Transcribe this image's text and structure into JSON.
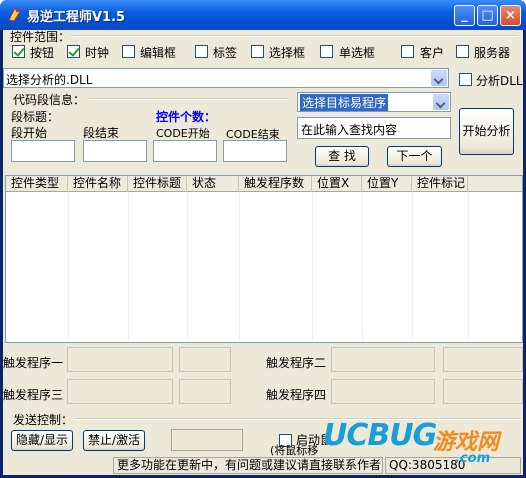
{
  "window": {
    "title": "易逆工程师V1.5",
    "min_label": "_",
    "max_label": "□",
    "close_label": "×"
  },
  "controls_range": {
    "label": "控件范围：",
    "items": [
      {
        "label": "按钮",
        "checked": true
      },
      {
        "label": "时钟",
        "checked": true
      },
      {
        "label": "编辑框",
        "checked": false
      },
      {
        "label": "标签",
        "checked": false
      },
      {
        "label": "选择框",
        "checked": false
      },
      {
        "label": "单选框",
        "checked": false
      },
      {
        "label": "客户",
        "checked": false
      },
      {
        "label": "服务器",
        "checked": false
      }
    ]
  },
  "dll_select": {
    "value": "选择分析的.DLL",
    "analyze_dll_label": "分析DLL",
    "analyze_dll_checked": false
  },
  "code_segment": {
    "group_label": "代码段信息：",
    "segment_title_label": "段标题：",
    "segment_start_label": "段开始",
    "segment_end_label": "段结束",
    "control_count_label": "控件个数：",
    "code_start_label": "CODE开始",
    "code_end_label": "CODE结束"
  },
  "target": {
    "program_select_value": "选择目标易程序",
    "search_input_value": "在此输入查找内容",
    "find_button": "查 找",
    "next_button": "下一个",
    "start_button": "开始分析"
  },
  "table": {
    "columns": [
      "控件类型",
      "控件名称",
      "控件标题",
      "状态",
      "触发程序数",
      "位置X",
      "位置Y",
      "控件标记"
    ],
    "rows": []
  },
  "triggers": {
    "trigger1_label": "触发程序一",
    "trigger2_label": "触发程序二",
    "trigger3_label": "触发程序三",
    "trigger4_label": "触发程序四"
  },
  "send_control": {
    "group_label": "发送控制：",
    "hide_show_button": "隐藏/显示",
    "disable_enable_button": "禁止/激活",
    "start_label": "启动鼠",
    "drag_hint": "(将鼠标移"
  },
  "status_bar": {
    "message": "更多功能在更新中，有问题或建议请直接联系作者",
    "qq": "QQ:3805180"
  },
  "watermark": {
    "brand": "UCBUG",
    "site_cn": "游戏网",
    "domain": ".com"
  },
  "colors": {
    "title_bar": "#0a5ee0",
    "client_bg": "#ece9d8",
    "blue_label": "#0000ff",
    "watermark_blue": "#1a9ed8",
    "watermark_orange": "#f08c1e"
  }
}
